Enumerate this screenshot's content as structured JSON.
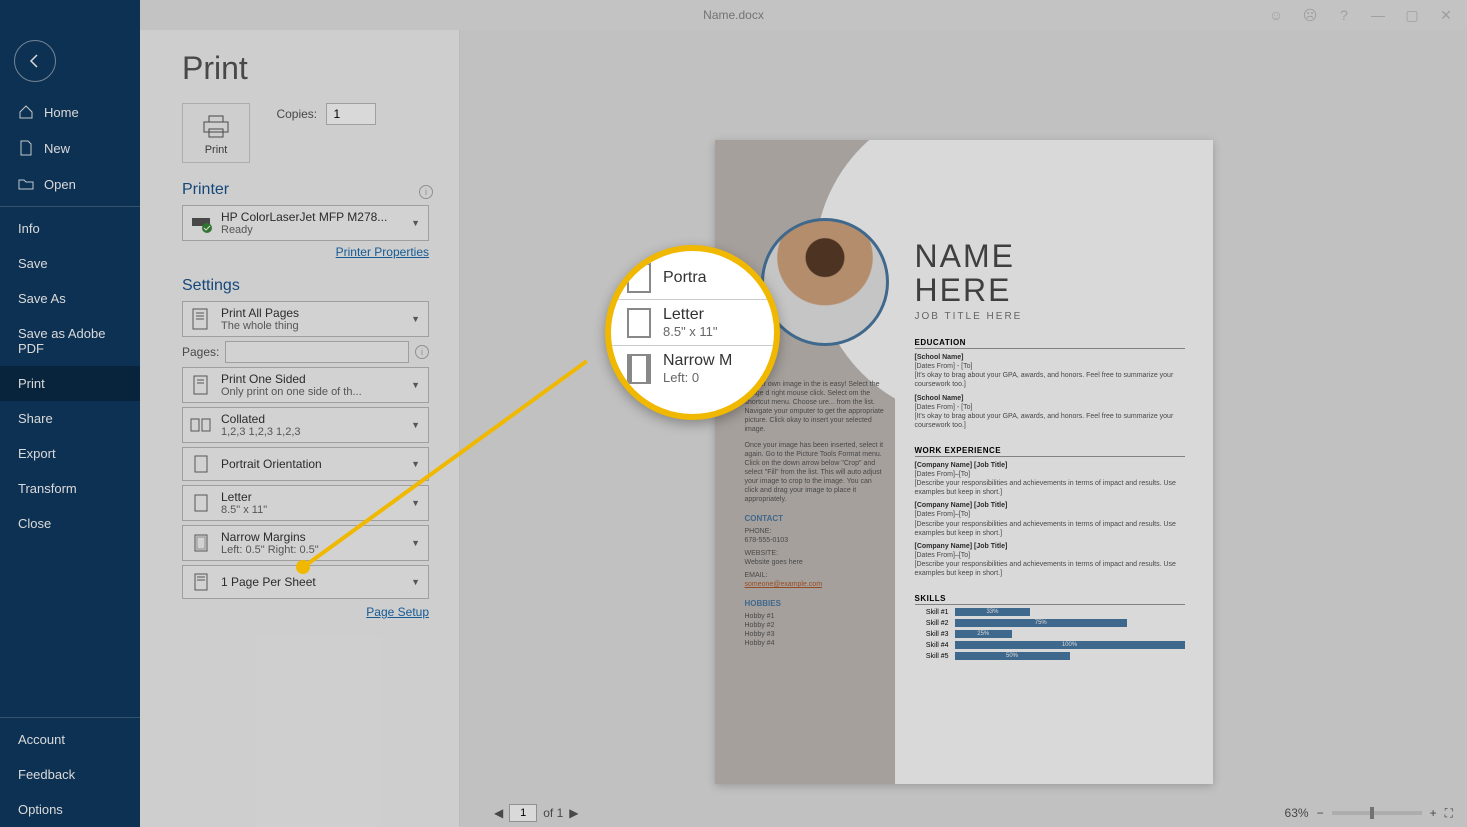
{
  "titlebar": {
    "doc_title": "Name.docx"
  },
  "sidebar": {
    "home": "Home",
    "new": "New",
    "open": "Open",
    "info": "Info",
    "save": "Save",
    "save_as": "Save As",
    "save_pdf": "Save as Adobe PDF",
    "print": "Print",
    "share": "Share",
    "export": "Export",
    "transform": "Transform",
    "close": "Close",
    "account": "Account",
    "feedback": "Feedback",
    "options": "Options"
  },
  "panel": {
    "title": "Print",
    "print_btn": "Print",
    "copies_label": "Copies:",
    "copies_value": "1",
    "printer_head": "Printer",
    "printer_name": "HP ColorLaserJet MFP M278...",
    "printer_status": "Ready",
    "printer_props": "Printer Properties",
    "settings_head": "Settings",
    "print_what_title": "Print All Pages",
    "print_what_sub": "The whole thing",
    "pages_label": "Pages:",
    "sided_title": "Print One Sided",
    "sided_sub": "Only print on one side of th...",
    "collated_title": "Collated",
    "collated_sub": "1,2,3    1,2,3    1,2,3",
    "orientation_title": "Portrait Orientation",
    "paper_title": "Letter",
    "paper_sub": "8.5\" x 11\"",
    "margins_title": "Narrow Margins",
    "margins_sub": "Left:  0.5\"     Right:  0.5\"",
    "sheet_title": "1 Page Per Sheet",
    "page_setup": "Page Setup"
  },
  "lens": {
    "row1_title": "Portra",
    "row2_title": "Letter",
    "row2_sub": "8.5\" x 11\"",
    "row3_title": "Narrow M",
    "row3_sub": "Left:  0"
  },
  "preview": {
    "page_current": "1",
    "page_of": "of 1",
    "zoom": "63%"
  },
  "resume": {
    "name1": "NAME",
    "name2": "HERE",
    "job": "JOB TITLE HERE",
    "edu_head": "EDUCATION",
    "school": "[School Name]",
    "dates": "[Dates From] - [To]",
    "edu_desc": "[It's okay to brag about your GPA, awards, and honors. Feel free to summarize your coursework too.]",
    "work_head": "WORK EXPERIENCE",
    "company": "[Company Name]  [Job Title]",
    "dates2": "[Dates From]–[To]",
    "work_desc": "[Describe your responsibilities and achievements in terms of impact and results. Use examples but keep in short.]",
    "skills_head": "SKILLS",
    "skills": [
      {
        "name": "Skill #1",
        "pct": 33
      },
      {
        "name": "Skill #2",
        "pct": 75
      },
      {
        "name": "Skill #3",
        "pct": 25
      },
      {
        "name": "Skill #4",
        "pct": 100
      },
      {
        "name": "Skill #5",
        "pct": 50
      }
    ],
    "left_instr": "ut your own image in the is easy! Select the image d right mouse click. Select om the shortcut menu. Choose ure... from the list. Navigate your omputer to get the appropriate picture. Click okay to insert your selected image.",
    "left_instr2": "Once your image has been inserted, select it again. Go to the Picture Tools Format menu. Click on the down arrow below \"Crop\" and select \"Fill\" from the list. This will auto adjust your image to crop to the image. You can click and drag your image to place it appropriately.",
    "contact_head": "CONTACT",
    "phone_lbl": "PHONE:",
    "phone": "678-555-0103",
    "website_lbl": "WEBSITE:",
    "website": "Website goes here",
    "email_lbl": "EMAIL:",
    "email": "someone@example.com",
    "hobbies_head": "HOBBIES",
    "hobbies": [
      "Hobby #1",
      "Hobby #2",
      "Hobby #3",
      "Hobby #4"
    ]
  }
}
